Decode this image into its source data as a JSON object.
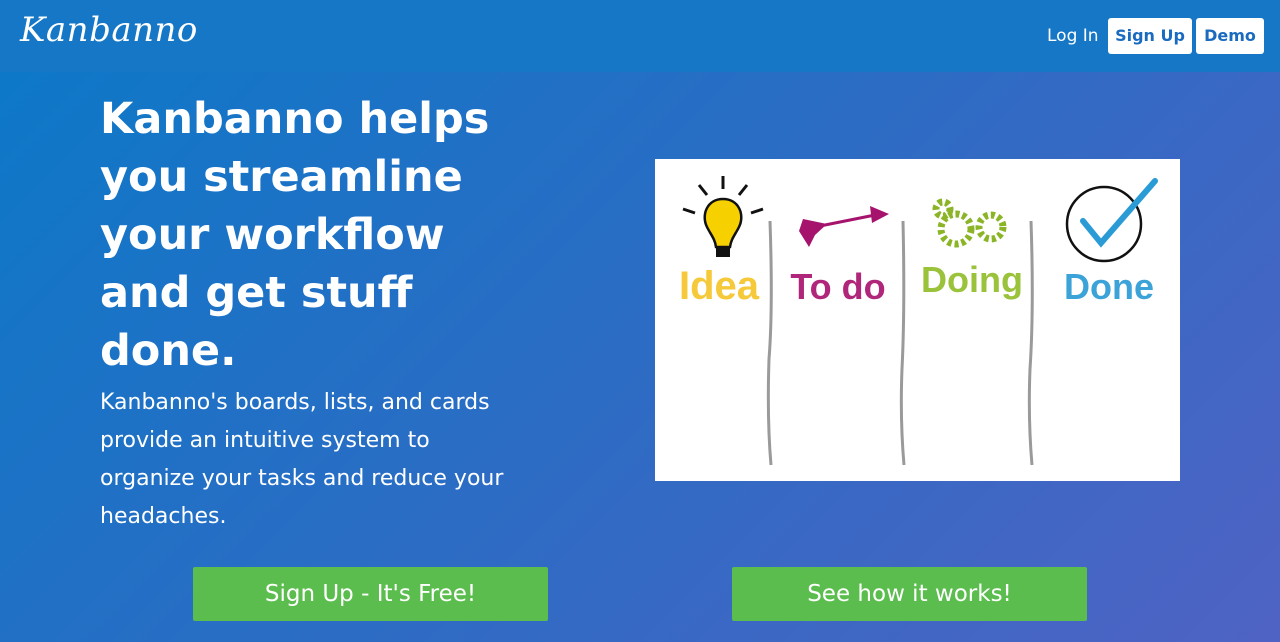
{
  "nav": {
    "logo": "Kanbanno",
    "login": "Log In",
    "signup": "Sign Up",
    "demo": "Demo"
  },
  "hero": {
    "headline": "Kanbanno helps you streamline your workflow and get stuff done.",
    "subtext": "Kanbanno's boards, lists, and cards provide an intuitive system to organize your tasks and reduce your headaches."
  },
  "board_illustration": {
    "columns": [
      "Idea",
      "To do",
      "Doing",
      "Done"
    ],
    "colors": {
      "idea": "#f5c93a",
      "todo": "#b0267a",
      "doing": "#9ac23b",
      "done": "#3ca3d9",
      "divider": "#9a9a9a"
    }
  },
  "cta": {
    "signup": "Sign Up - It's Free!",
    "how": "See how it works!"
  },
  "colors": {
    "nav_bg": "#1577c5",
    "cta_bg": "#5cbd4f"
  }
}
